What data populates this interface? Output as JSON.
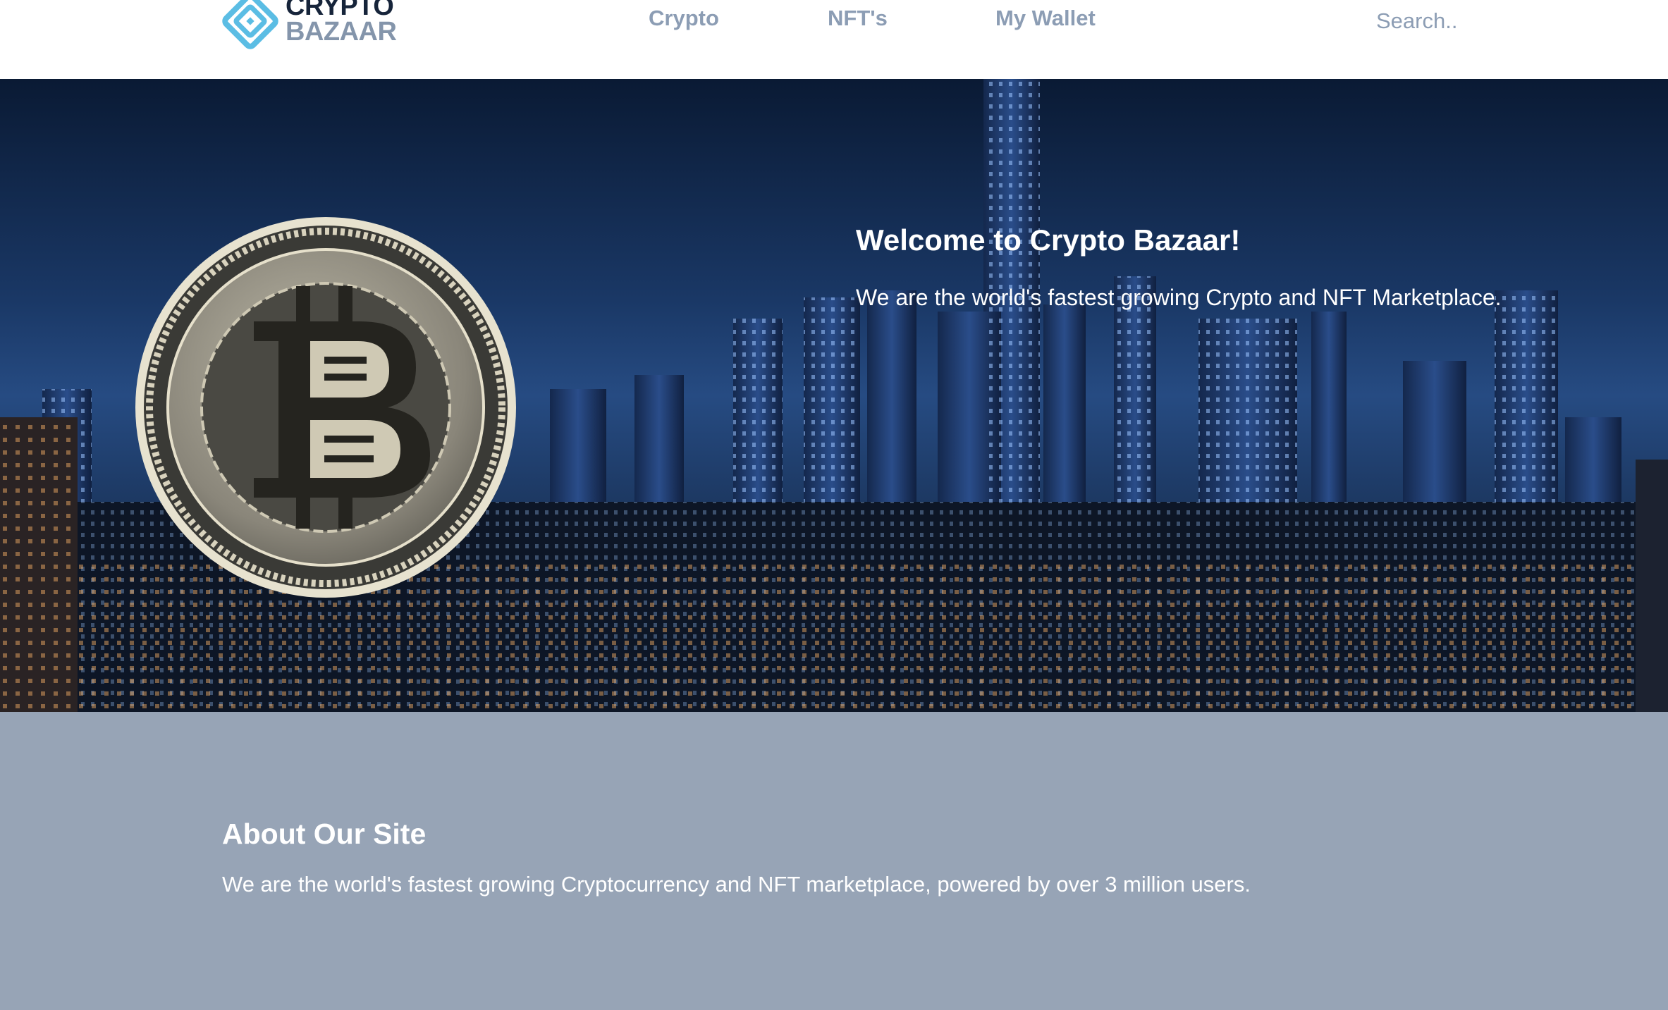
{
  "header": {
    "logo": {
      "line1": "CRYPTO",
      "line2": "BAZAAR",
      "icon": "crypto-bazaar-logo-icon"
    },
    "nav": [
      {
        "label": "Crypto"
      },
      {
        "label": "NFT's"
      },
      {
        "label": "My Wallet"
      }
    ],
    "search": {
      "placeholder": "Search..",
      "value": ""
    }
  },
  "hero": {
    "title": "Welcome to Crypto Bazaar!",
    "subtitle": "We are the world's fastest growing Crypto and NFT Marketplace.",
    "background": "night-city-skyline-image",
    "coin_image": "bitcoin-coin-image"
  },
  "about": {
    "title": "About Our Site",
    "text": "We are the world's fastest growing Cryptocurrency and NFT marketplace, powered by over 3 million users."
  },
  "colors": {
    "nav_text": "#8c9db4",
    "logo_dark": "#16243a",
    "logo_light": "#8495ab",
    "logo_icon": "#5bbde4",
    "about_bg": "#97a4b6"
  }
}
